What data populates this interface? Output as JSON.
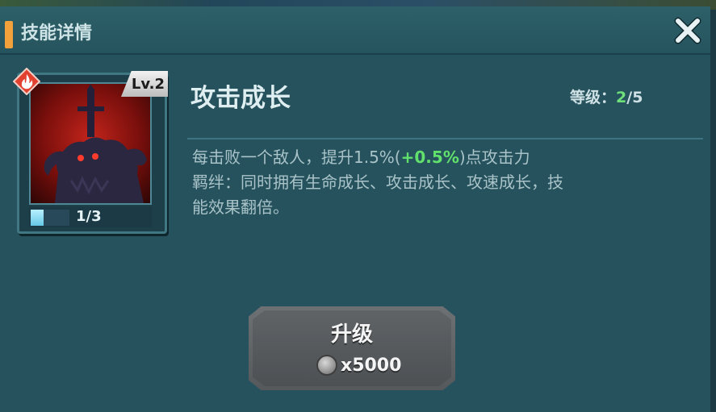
{
  "header": {
    "title": "技能详情"
  },
  "close_icon": "close-icon",
  "skill": {
    "level_badge": "Lv.2",
    "element_icon": "fire-icon",
    "name": "攻击成长",
    "level_label": "等级：",
    "level_current": "2",
    "level_max": "/5",
    "progress_text": "1/3",
    "progress_fraction": 0.333
  },
  "description": {
    "line1_prefix": "每击败一个敌人，提升1.5%(",
    "line1_bonus": "+0.5%",
    "line1_suffix": ")点攻击力",
    "line2": "羁绊：同时拥有生命成长、攻击成长、攻速成长，技",
    "line3": "能效果翻倍。"
  },
  "upgrade": {
    "label": "升级",
    "cost": "x5000",
    "currency_icon": "coin-icon"
  },
  "colors": {
    "accent": "#f3a23b",
    "bonus": "#61e06b",
    "panel": "#27535f"
  }
}
